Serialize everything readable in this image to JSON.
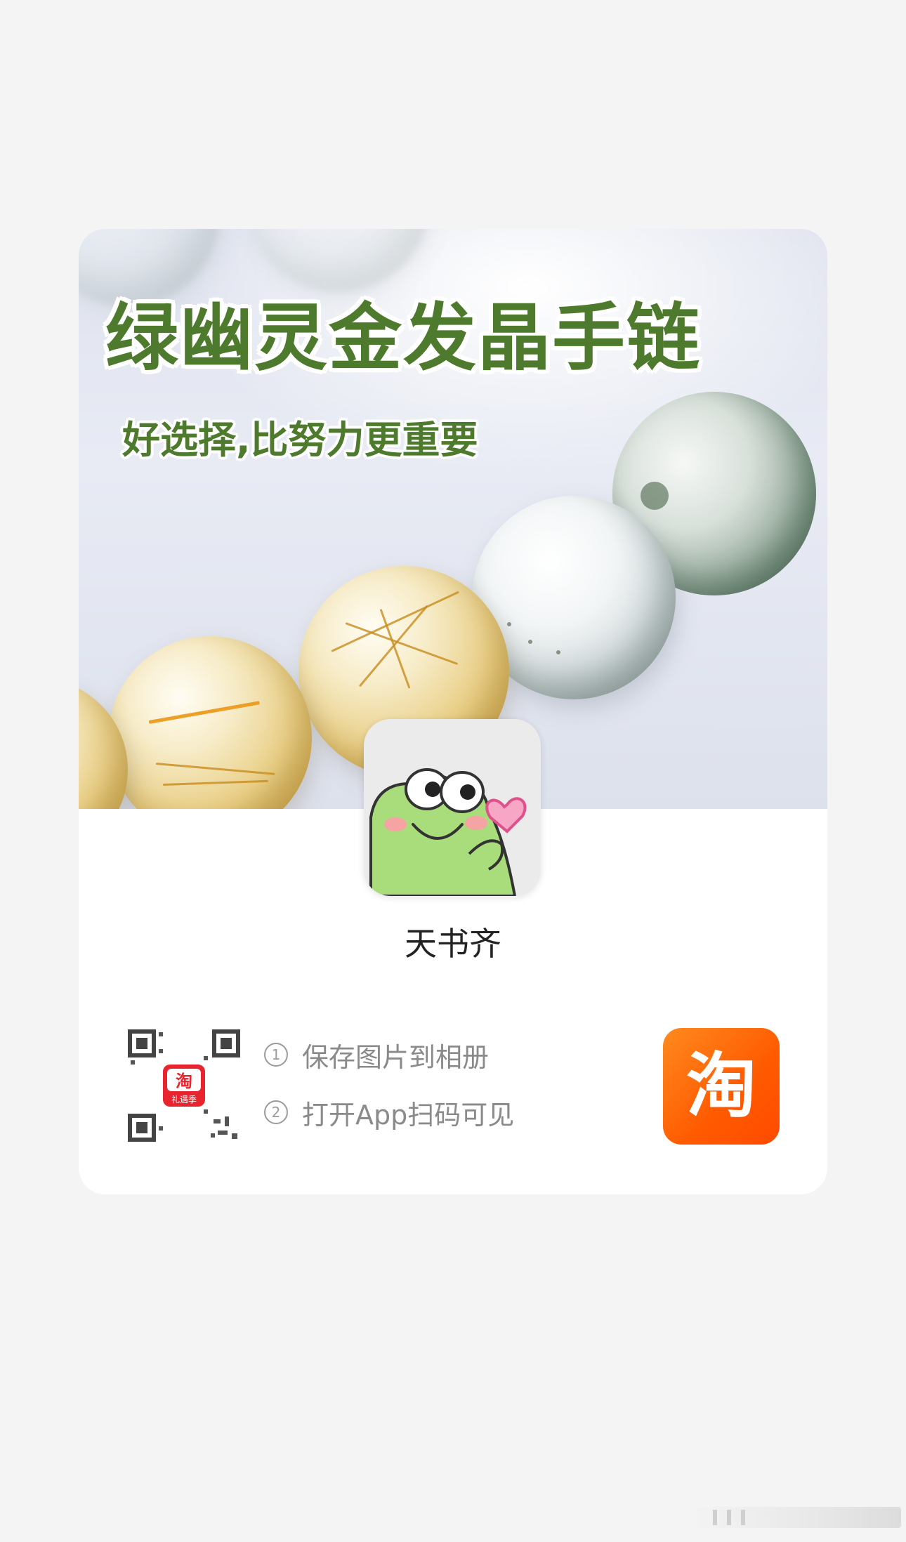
{
  "banner": {
    "title": "绿幽灵金发晶手链",
    "subtitle": "好选择,比努力更重要"
  },
  "shop": {
    "name": "天书齐",
    "avatar_icon": "frog-heart-sticker-icon"
  },
  "qr_code": {
    "center_logo_text": "淘",
    "center_logo_sub": "礼遇季"
  },
  "steps": [
    {
      "num": "1",
      "label": "保存图片到相册"
    },
    {
      "num": "2",
      "label": "打开App扫码可见"
    }
  ],
  "app_logo": {
    "text": "淘",
    "icon": "taobao-logo-icon",
    "color": "#ff5a00"
  },
  "colors": {
    "title_green": "#4d7a2c",
    "card_bg": "#ffffff",
    "page_bg": "#f4f4f4"
  }
}
